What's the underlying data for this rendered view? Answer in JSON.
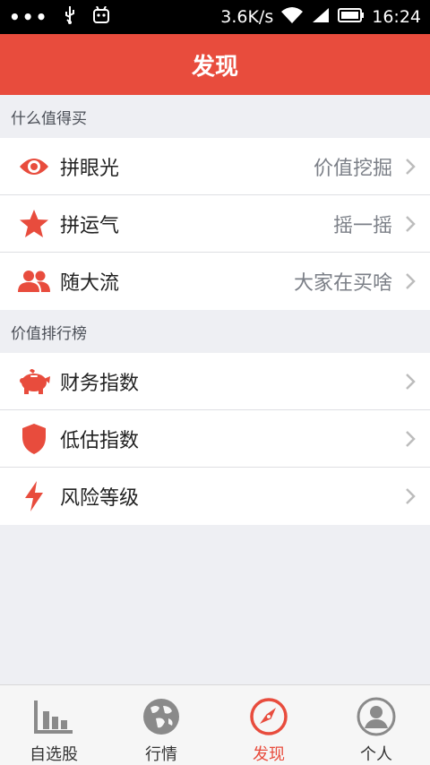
{
  "status_bar": {
    "network_speed": "3.6K/s",
    "time": "16:24",
    "dots": "•••"
  },
  "header": {
    "title": "发现"
  },
  "sections": [
    {
      "title": "什么值得买",
      "items": [
        {
          "label": "拼眼光",
          "value": "价值挖掘",
          "icon": "eye-icon"
        },
        {
          "label": "拼运气",
          "value": "摇一摇",
          "icon": "star-icon"
        },
        {
          "label": "随大流",
          "value": "大家在买啥",
          "icon": "people-icon"
        }
      ]
    },
    {
      "title": "价值排行榜",
      "items": [
        {
          "label": "财务指数",
          "value": "",
          "icon": "piggy-bank-icon"
        },
        {
          "label": "低估指数",
          "value": "",
          "icon": "shield-icon"
        },
        {
          "label": "风险等级",
          "value": "",
          "icon": "lightning-icon"
        }
      ]
    }
  ],
  "tabbar": {
    "tabs": [
      {
        "label": "自选股",
        "icon": "bar-chart-icon",
        "active": false
      },
      {
        "label": "行情",
        "icon": "globe-icon",
        "active": false
      },
      {
        "label": "发现",
        "icon": "compass-icon",
        "active": true
      },
      {
        "label": "个人",
        "icon": "person-icon",
        "active": false
      }
    ]
  },
  "colors": {
    "accent": "#e84c3d",
    "background": "#eeeff3",
    "icon_gray": "#8a8a8a"
  }
}
